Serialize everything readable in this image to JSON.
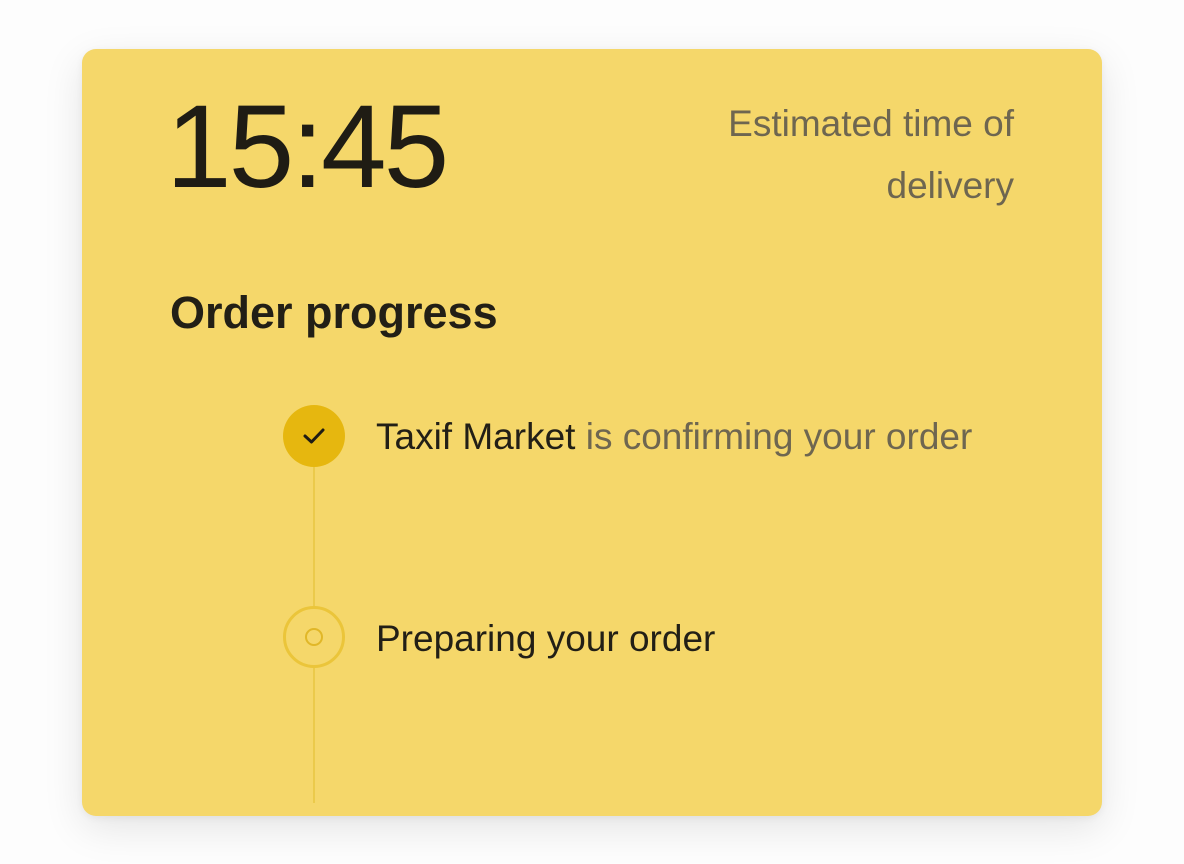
{
  "eta": {
    "time": "15:45",
    "label": "Estimated time of delivery"
  },
  "progress": {
    "title": "Order progress",
    "steps": [
      {
        "merchant": "Taxif Market",
        "text": " is confirming your order",
        "status": "done",
        "icon": "check-icon"
      },
      {
        "text": "Preparing your order",
        "status": "pending",
        "icon": "pending-circle-icon"
      }
    ]
  },
  "colors": {
    "card_background": "#f5d76a",
    "accent": "#e6b70f",
    "primary_text": "#221f16",
    "secondary_text": "#6e6650"
  }
}
